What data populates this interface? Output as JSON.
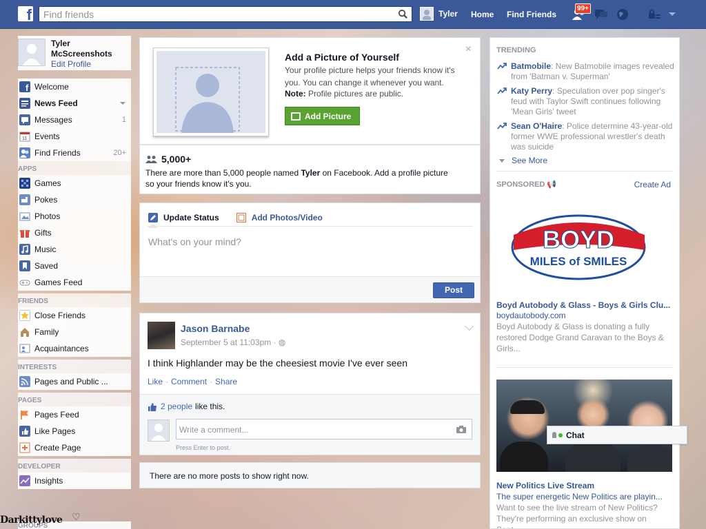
{
  "topbar": {
    "logo": "f",
    "search_placeholder": "Find friends",
    "user_name": "Tyler",
    "home": "Home",
    "find_friends": "Find Friends",
    "notification_badge": "99+",
    "brand_color": "#3b5998"
  },
  "profile": {
    "name": "Tyler McScreenshots",
    "edit": "Edit Profile"
  },
  "nav": {
    "main": [
      {
        "label": "Welcome",
        "icon": "facebook-icon",
        "count": ""
      },
      {
        "label": "News Feed",
        "icon": "news-feed-icon",
        "count": ""
      },
      {
        "label": "Messages",
        "icon": "messages-icon",
        "count": "1"
      },
      {
        "label": "Events",
        "icon": "calendar-icon",
        "count": ""
      },
      {
        "label": "Find Friends",
        "icon": "find-friends-icon",
        "count": "20+"
      }
    ],
    "apps_header": "APPS",
    "apps": [
      {
        "label": "Games",
        "icon": "games-icon"
      },
      {
        "label": "Pokes",
        "icon": "pokes-icon"
      },
      {
        "label": "Photos",
        "icon": "photos-icon"
      },
      {
        "label": "Gifts",
        "icon": "gift-icon"
      },
      {
        "label": "Music",
        "icon": "music-icon"
      },
      {
        "label": "Saved",
        "icon": "bookmark-icon"
      },
      {
        "label": "Games Feed",
        "icon": "controller-icon"
      }
    ],
    "friends_header": "FRIENDS",
    "friends": [
      {
        "label": "Close Friends",
        "icon": "star-icon"
      },
      {
        "label": "Family",
        "icon": "house-icon"
      },
      {
        "label": "Acquaintances",
        "icon": "acquaintances-icon"
      }
    ],
    "interests_header": "INTERESTS",
    "interests": [
      {
        "label": "Pages and Public ...",
        "icon": "rss-icon"
      }
    ],
    "pages_header": "PAGES",
    "pages": [
      {
        "label": "Pages Feed",
        "icon": "flag-icon"
      },
      {
        "label": "Like Pages",
        "icon": "like-icon"
      },
      {
        "label": "Create Page",
        "icon": "plus-icon"
      }
    ],
    "developer_header": "DEVELOPER",
    "developer": [
      {
        "label": "Insights",
        "icon": "chart-icon"
      }
    ],
    "groups_header": "GROUPS"
  },
  "addpic": {
    "title": "Add a Picture of Yourself",
    "desc": "Your profile picture helps your friends know it's you. You can change it whenever you want.",
    "note_bold": "Note:",
    "note_text": " Profile pictures are public.",
    "button": "Add Picture",
    "close": "×"
  },
  "names": {
    "count": "5,000+",
    "text_before": "There are more than 5,000 people named ",
    "name": "Tyler",
    "text_after": " on Facebook. Add a profile picture so your friends know it's you."
  },
  "composer": {
    "tab_status": "Update Status",
    "tab_photos": "Add Photos/Video",
    "placeholder": "What's on your mind?",
    "post_button": "Post"
  },
  "post": {
    "author": "Jason Barnabe",
    "time": "September 5 at 11:03pm ·",
    "body": "I think Highlander may be the cheesiest movie I've ever seen",
    "like": "Like",
    "comment": "Comment",
    "share": "Share",
    "dot": "·",
    "likes_link": "2 people",
    "likes_rest": "like this.",
    "comment_placeholder": "Write a comment...",
    "hint": "Press Enter to post."
  },
  "feed_end": "There are no more posts to show right now.",
  "trending": {
    "header": "TRENDING",
    "items": [
      {
        "topic": "Batmobile",
        "text": ": New Batmobile images revealed from 'Batman v. Superman'"
      },
      {
        "topic": "Katy Perry",
        "text": ": Speculation over pop singer's feud with Taylor Swift continues following 'Mean Girls' tweet"
      },
      {
        "topic": "Sean O'Haire",
        "text": ": Police determine 43-year-old former WWE professional wrestler's death was suicide"
      }
    ],
    "see_more": "See More"
  },
  "sponsored": {
    "header": "SPONSORED",
    "create_ad": "Create Ad",
    "ad1": {
      "logo_word": "BOYD",
      "logo_tagline": "MILES of SMILES",
      "title": "Boyd Autobody & Glass - Boys & Girls Clu...",
      "url": "boydautobody.com",
      "desc": "Boyd Autobody & Glass is donating a fully restored Dodge Grand Caravan to the Boys & Girls..."
    },
    "ad2": {
      "title": "New Politics Live Stream",
      "subtitle": "The super energetic New Politics are playin...",
      "desc": "Want to see the live stream of New Politics? They're performing an exclusive show on Sept..."
    }
  },
  "chat": {
    "label": "Chat"
  },
  "watermark": "Darkittylove"
}
